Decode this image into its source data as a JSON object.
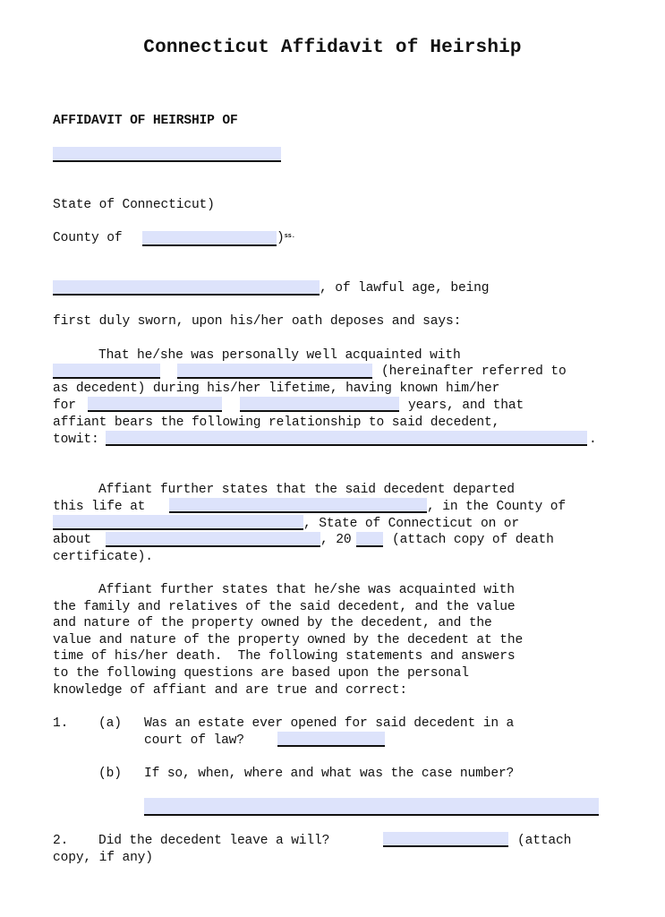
{
  "document": {
    "title": "Connecticut Affidavit of Heirship",
    "heading": "AFFIDAVIT OF HEIRSHIP OF",
    "venue": {
      "state_line": "State of Connecticut)",
      "county_label": "County of ",
      "county_suffix": ")",
      "ss_mark": "ss."
    },
    "intro": {
      "after_name": ", of lawful age, being",
      "line2": "first duly sworn, upon his/her oath deposes and says:"
    },
    "para1": {
      "line1": "That he/she was personally well acquainted with",
      "after_name": "(hereinafter referred to",
      "line3": "as decedent) during his/her lifetime, having known him/her",
      "for_label": "for",
      "years_text": "years, and that",
      "line5": "affiant bears the following relationship to said decedent,",
      "towit_label": "towit:",
      "period": "."
    },
    "para2": {
      "line1": "Affiant further states that the said decedent departed",
      "life_at": "this life at",
      "county_of": ", in the County of",
      "state_text": ", State of Connecticut on or",
      "about_label": "about",
      "year_prefix": ", 20",
      "attach_text": "(attach copy of death",
      "line5": "certificate)."
    },
    "para3": {
      "lines": [
        "Affiant further states that he/she was acquainted with",
        "the family and relatives of the said decedent, and the value",
        "and nature of the property owned by the decedent, and the",
        "value and nature of the property owned by the decedent at the",
        "time of his/her death.  The following statements and answers",
        "to the following questions are based upon the personal",
        "knowledge of affiant and are true and correct:"
      ]
    },
    "questions": {
      "q1_number": "1.",
      "q1a_label": "(a)",
      "q1a_line1": "Was an estate ever opened for said decedent in a",
      "q1a_line2": "court of law?",
      "q1b_label": "(b)",
      "q1b_text": "If so, when, where and what was the case number?",
      "q2_number": "2.",
      "q2_text": "Did the decedent leave a will?",
      "q2_attach": "(attach",
      "q2_line2": "copy, if any)"
    },
    "fields": {
      "decedent_name": "",
      "county": "",
      "affiant_name": "",
      "decedent_first": "",
      "decedent_last": "",
      "known_for_1": "",
      "known_for_2": "",
      "relationship": "",
      "death_place": "",
      "death_county": "",
      "death_date": "",
      "death_year": "",
      "estate_opened": "",
      "case_details": "",
      "left_will": ""
    },
    "colors": {
      "field_fill": "#dde3fb",
      "text": "#111111"
    }
  }
}
